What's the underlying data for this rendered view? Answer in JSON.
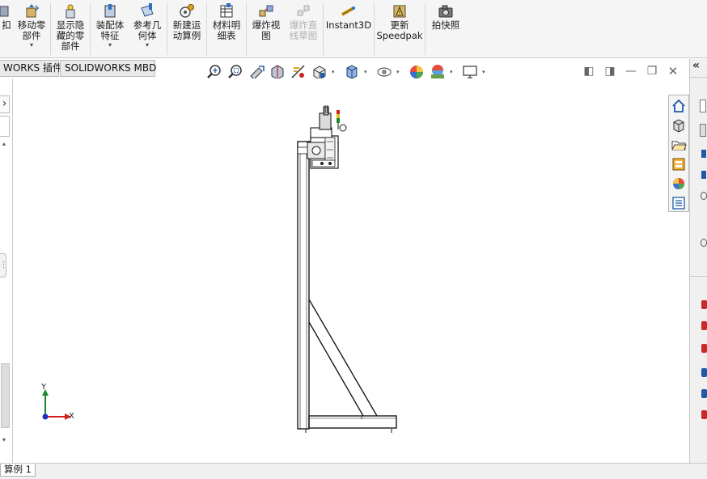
{
  "ribbon": {
    "buttons": [
      {
        "label_line1": "扣",
        "label_line2": "",
        "label_line3": ""
      },
      {
        "label_line1": "移动零",
        "label_line2": "部件",
        "label_line3": ""
      },
      {
        "label_line1": "显示隐",
        "label_line2": "藏的零",
        "label_line3": "部件"
      },
      {
        "label_line1": "装配体",
        "label_line2": "特征",
        "label_line3": ""
      },
      {
        "label_line1": "参考几",
        "label_line2": "何体",
        "label_line3": ""
      },
      {
        "label_line1": "新建运",
        "label_line2": "动算例",
        "label_line3": ""
      },
      {
        "label_line1": "材料明",
        "label_line2": "细表",
        "label_line3": ""
      },
      {
        "label_line1": "爆炸视",
        "label_line2": "图",
        "label_line3": ""
      },
      {
        "label_line1": "爆炸直",
        "label_line2": "线草图",
        "label_line3": ""
      },
      {
        "label_line1": "Instant3D",
        "label_line2": "",
        "label_line3": ""
      },
      {
        "label_line1": "更新",
        "label_line2": "Speedpak",
        "label_line3": ""
      },
      {
        "label_line1": "拍快照",
        "label_line2": "",
        "label_line3": ""
      }
    ],
    "dropdown_arrow": "▾"
  },
  "tabs": [
    {
      "label": "WORKS 插件"
    },
    {
      "label": "SOLIDWORKS MBD"
    }
  ],
  "window_controls": {
    "restore_left": "◧",
    "restore_right": "◨",
    "minimize": "—",
    "maximize": "❐",
    "close": "✕"
  },
  "left_panel": {
    "expand_arrow": "›",
    "scroll_up": "▴",
    "scroll_down": "▾",
    "grip": "⋮"
  },
  "triad": {
    "y_label": "Y",
    "x_label": "X"
  },
  "task_pane": {
    "collapse_label": "«"
  },
  "status_bar": {
    "motion_tab": "算例 1"
  },
  "colors": {
    "ribbon_bg": "#f5f5f5",
    "accent_blue": "#1f5aa8",
    "triad_red": "#d21f1f",
    "triad_green": "#1a8a2a",
    "triad_blue": "#1a2fbf"
  },
  "icons": [
    "zoom-to-fit-icon",
    "zoom-area-icon",
    "previous-view-icon",
    "section-view-icon",
    "dynamic-annotation-icon",
    "view-orientation-icon",
    "display-style-icon",
    "hide-show-icon",
    "edit-appearance-icon",
    "apply-scene-icon",
    "view-settings-icon",
    "home-icon",
    "parts-library-icon",
    "file-explorer-icon",
    "view-palette-icon",
    "appearances-icon",
    "custom-properties-icon",
    "camera-icon"
  ]
}
